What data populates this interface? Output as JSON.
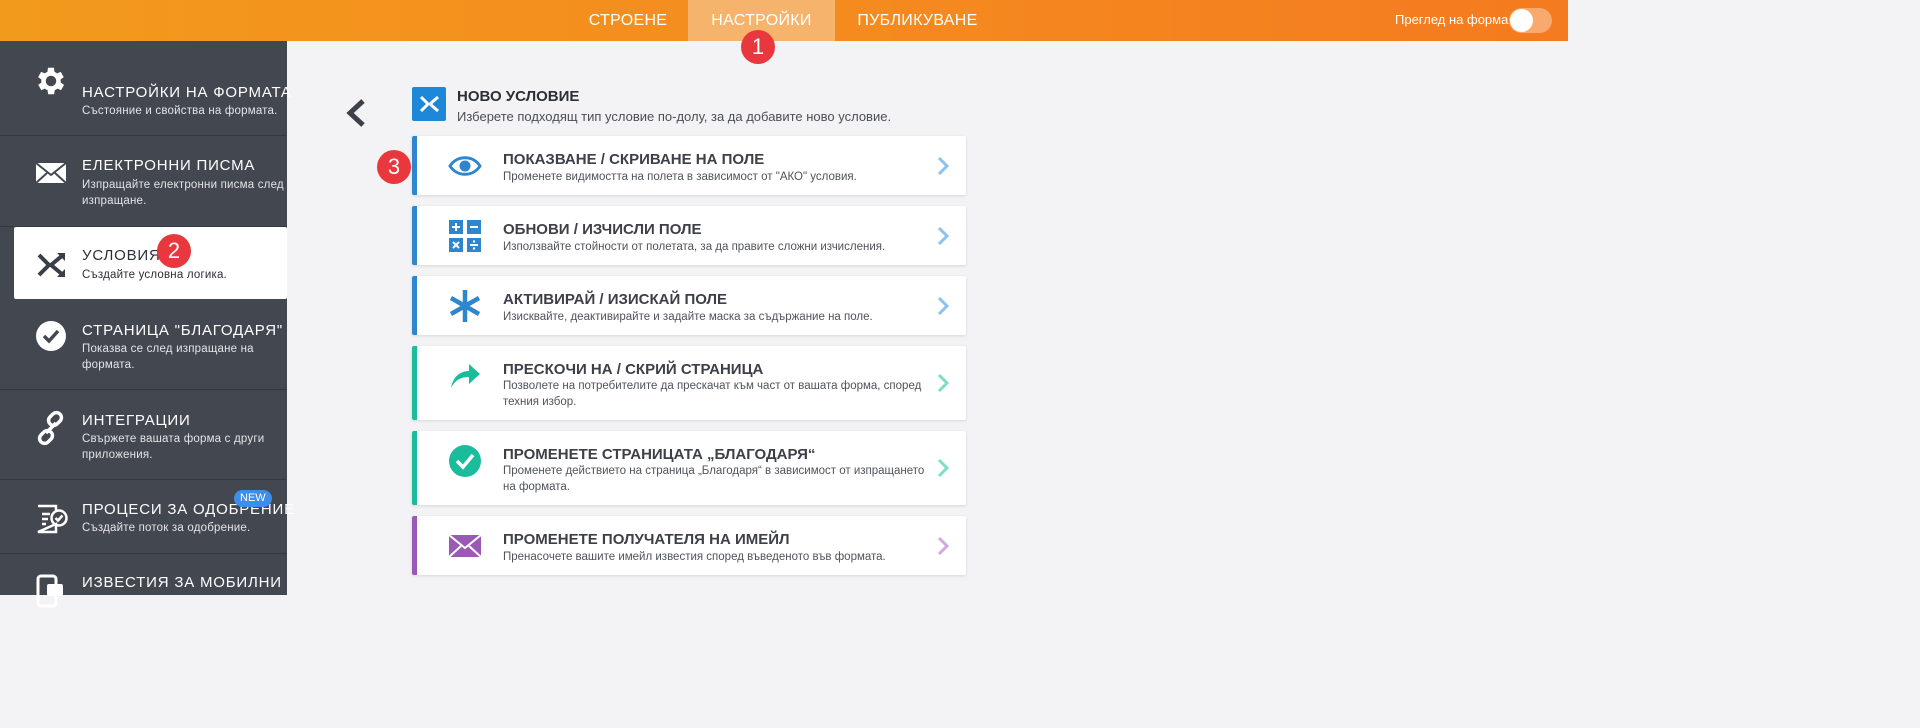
{
  "topbar": {
    "tabs": [
      {
        "label": "СТРОЕНЕ"
      },
      {
        "label": "НАСТРОЙКИ"
      },
      {
        "label": "ПУБЛИКУВАНЕ"
      }
    ],
    "preview_label": "Преглед на форма"
  },
  "sidebar": {
    "items": [
      {
        "title": "НАСТРОЙКИ НА ФОРМАТА",
        "desc": "Състояние и свойства на формата.",
        "icon": "gear-icon"
      },
      {
        "title": "ЕЛЕКТРОННИ ПИСМА",
        "desc": "Изпращайте електронни писма след изпращане.",
        "icon": "envelope-icon"
      },
      {
        "title": "УСЛОВИЯ",
        "desc": "Създайте условна логика.",
        "icon": "conditions-icon"
      },
      {
        "title": "СТРАНИЦА \"БЛАГОДАРЯ\"",
        "desc": "Показва се след изпращане на формата.",
        "icon": "check-circle-icon"
      },
      {
        "title": "ИНТЕГРАЦИИ",
        "desc": "Свържете вашата форма с други приложения.",
        "icon": "link-icon"
      },
      {
        "title": "ПРОЦЕСИ ЗА ОДОБРЕНИЕ",
        "desc": "Създайте поток за одобрение.",
        "icon": "approval-icon",
        "badge": "NEW"
      },
      {
        "title": "ИЗВЕСТИЯ ЗА МОБИЛНИ",
        "desc": "",
        "icon": "mobile-notification-icon"
      }
    ]
  },
  "main": {
    "header": {
      "title": "НОВО УСЛОВИЕ",
      "desc": "Изберете подходящ тип условие по-долу, за да добавите ново условие."
    },
    "cards": [
      {
        "title": "ПОКАЗВАНЕ / СКРИВАНЕ НА ПОЛЕ",
        "desc": "Променете видимостта на полета в зависимост от \"АКО\" условия.",
        "icon": "eye-icon",
        "color": "#2e86cf"
      },
      {
        "title": "ОБНОВИ / ИЗЧИСЛИ ПОЛЕ",
        "desc": "Използвайте стойности от полетата, за да правите сложни изчисления.",
        "icon": "calculator-icon",
        "color": "#2e86cf"
      },
      {
        "title": "АКТИВИРАЙ / ИЗИСКАЙ ПОЛЕ",
        "desc": "Изисквайте, деактивирайте и задайте маска за съдържание на поле.",
        "icon": "asterisk-icon",
        "color": "#2e86cf"
      },
      {
        "title": "ПРЕСКОЧИ НА / СКРИЙ СТРАНИЦА",
        "desc": "Позволете на потребителите да прескачат към част от вашата форма, според техния избор.",
        "icon": "share-arrow-icon",
        "color": "#1bbc9b"
      },
      {
        "title": "ПРОМЕНЕТЕ СТРАНИЦАТА „БЛАГОДАРЯ“",
        "desc": "Променете действието на страница „Благодаря“ в зависимост от изпращането на формата.",
        "icon": "check-circle-icon",
        "color": "#1bbc9b"
      },
      {
        "title": "ПРОМЕНЕТЕ ПОЛУЧАТЕЛЯ НА ИМЕЙЛ",
        "desc": "Пренасочете вашите имейл известия според въведеното във формата.",
        "icon": "envelope-icon",
        "color": "#9b59b6"
      }
    ]
  },
  "markers": [
    "1",
    "2",
    "3"
  ],
  "colors": {
    "topbar": "#f58a1f",
    "sidebar": "#43474f",
    "blue": "#2e86cf",
    "teal": "#1bbc9b",
    "purple": "#9b59b6",
    "marker": "#e8383d"
  }
}
